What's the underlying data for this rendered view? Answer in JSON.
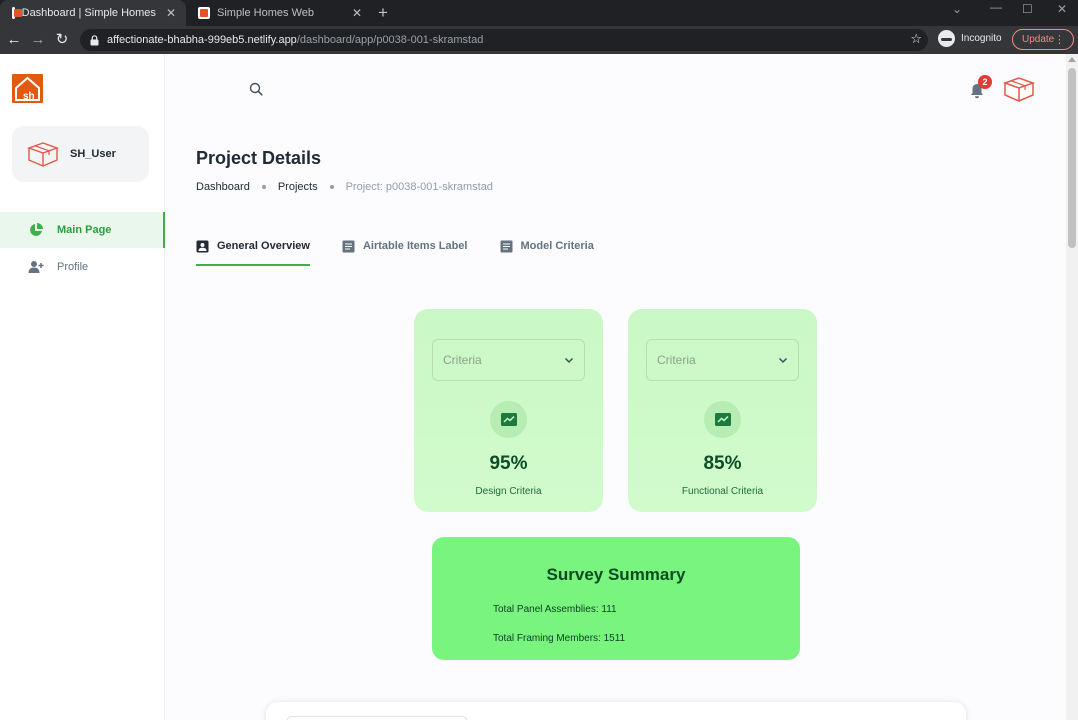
{
  "browser": {
    "tabs": [
      {
        "title": "Dashboard | Simple Homes",
        "active": true
      },
      {
        "title": "Simple Homes Web",
        "active": false
      }
    ],
    "url_host": "affectionate-bhabha-999eb5.netlify.app",
    "url_path": "/dashboard/app/p0038-001-skramstad",
    "incognito_label": "Incognito",
    "update_label": "Update"
  },
  "sidebar": {
    "account_name": "SH_User",
    "items": [
      {
        "label": "Main Page",
        "active": true
      },
      {
        "label": "Profile",
        "active": false
      }
    ]
  },
  "header": {
    "notification_count": "2"
  },
  "page": {
    "title": "Project Details",
    "breadcrumb": [
      "Dashboard",
      "Projects",
      "Project: p0038-001-skramstad"
    ],
    "tabs": [
      {
        "label": "General Overview",
        "active": true
      },
      {
        "label": "Airtable Items Label",
        "active": false
      },
      {
        "label": "Model Criteria",
        "active": false
      }
    ]
  },
  "cards": [
    {
      "select_placeholder": "Criteria",
      "percent": "95%",
      "label": "Design Criteria"
    },
    {
      "select_placeholder": "Criteria",
      "percent": "85%",
      "label": "Functional Criteria"
    }
  ],
  "survey": {
    "title": "Survey Summary",
    "rows": [
      {
        "label": "Total Panel Assemblies:",
        "value": "111"
      },
      {
        "label": "Total Framing Members:",
        "value": "1511"
      }
    ]
  },
  "colors": {
    "accent": "#3cb148",
    "logo": "#e05a12",
    "card_bg": "#ccf9c8",
    "survey_bg": "#79f47f",
    "badge": "#e53935"
  },
  "icons": {
    "search": "search-icon",
    "bell": "bell-icon",
    "main_page": "pie-chart-icon",
    "profile": "user-add-icon",
    "tab_general": "contact-card-icon",
    "tab_airtable": "document-icon",
    "tab_model": "document-icon",
    "card": "trending-chart-icon"
  }
}
